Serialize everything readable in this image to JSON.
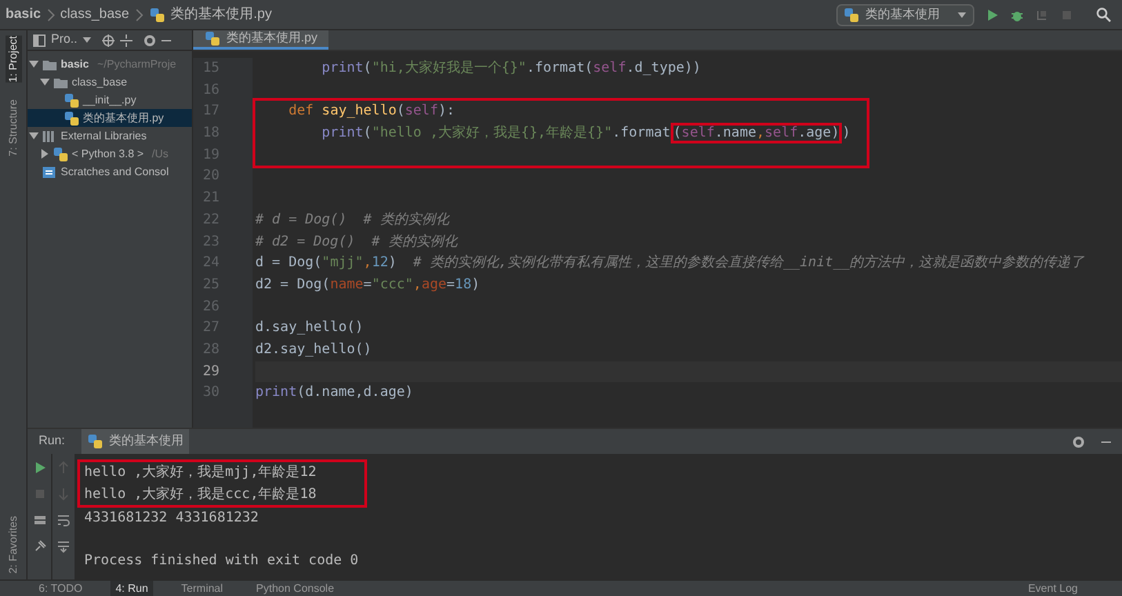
{
  "navbar": {
    "breadcrumbs": [
      "basic",
      "class_base",
      "类的基本使用.py"
    ],
    "run_config": "类的基本使用"
  },
  "tool_stripe": {
    "top": [
      {
        "label": "1: Project",
        "selected": true
      },
      {
        "label": "7: Structure",
        "selected": false
      }
    ],
    "bottom": [
      {
        "label": "2: Favorites",
        "selected": false
      }
    ]
  },
  "project": {
    "title": "Pro..",
    "tree": [
      {
        "label": "basic",
        "hint": "~/PycharmProje",
        "kind": "folder",
        "expanded": true,
        "selected": false,
        "children": [
          {
            "label": "class_base",
            "kind": "folder",
            "expanded": true,
            "selected": false,
            "children": [
              {
                "label": "__init__.py",
                "kind": "python",
                "selected": false
              },
              {
                "label": "类的基本使用.py",
                "kind": "python",
                "selected": true
              }
            ]
          }
        ]
      },
      {
        "label": "External Libraries",
        "kind": "library",
        "expanded": true,
        "selected": false,
        "children": [
          {
            "label": "< Python 3.8 >",
            "hint": "/Us",
            "kind": "sdk",
            "expanded": false,
            "selected": false
          }
        ]
      },
      {
        "label": "Scratches and Consol",
        "kind": "scratch",
        "selected": false
      }
    ]
  },
  "editor": {
    "tabs": [
      {
        "label": "类的基本使用.py",
        "selected": true
      }
    ],
    "code": [
      {
        "kind": "line",
        "number": "15",
        "current": false,
        "tokens": [
          {
            "kind": "builtin",
            "text": "        print"
          },
          {
            "kind": "plain",
            "text": "("
          },
          {
            "kind": "string",
            "text": "\"hi,大家好我是一个{}\""
          },
          {
            "kind": "plain",
            "text": ".format("
          },
          {
            "kind": "self",
            "text": "self"
          },
          {
            "kind": "plain",
            "text": ".d_type))"
          }
        ]
      },
      {
        "kind": "line",
        "number": "16",
        "current": false
      },
      {
        "kind": "box",
        "lines": [
          {
            "kind": "line",
            "number": "17",
            "current": false,
            "tokens": [
              {
                "kind": "keyword",
                "text": "    def "
              },
              {
                "kind": "function",
                "text": "say_hello"
              },
              {
                "kind": "plain",
                "text": "("
              },
              {
                "kind": "self",
                "text": "self"
              },
              {
                "kind": "plain",
                "text": "):"
              }
            ]
          },
          {
            "kind": "line",
            "number": "18",
            "current": false,
            "tokens": [
              {
                "kind": "builtin",
                "text": "        print"
              },
              {
                "kind": "plain",
                "text": "("
              },
              {
                "kind": "string",
                "text": "\"hello ,大家好，我是{},年龄是{}\""
              },
              {
                "kind": "plain",
                "text": ".format"
              },
              {
                "kind": "box",
                "tokens": [
                  {
                    "kind": "plain",
                    "text": "("
                  },
                  {
                    "kind": "self",
                    "text": "self"
                  },
                  {
                    "kind": "plain",
                    "text": ".name"
                  },
                  {
                    "kind": "keyword",
                    "text": ","
                  },
                  {
                    "kind": "self",
                    "text": "self"
                  },
                  {
                    "kind": "plain",
                    "text": ".age)"
                  }
                ]
              },
              {
                "kind": "plain",
                "text": ")"
              }
            ]
          },
          {
            "kind": "line",
            "number": "19",
            "current": false
          }
        ]
      },
      {
        "kind": "line",
        "number": "20",
        "current": false
      },
      {
        "kind": "line",
        "number": "21",
        "current": false
      },
      {
        "kind": "line",
        "number": "22",
        "current": false,
        "tokens": [
          {
            "kind": "comment",
            "text": "# d = Dog()  # 类的实例化"
          }
        ]
      },
      {
        "kind": "line",
        "number": "23",
        "current": false,
        "tokens": [
          {
            "kind": "comment",
            "text": "# d2 = Dog()  # 类的实例化"
          }
        ]
      },
      {
        "kind": "line",
        "number": "24",
        "current": false,
        "tokens": [
          {
            "kind": "plain",
            "text": "d = Dog("
          },
          {
            "kind": "string",
            "text": "\"mjj\""
          },
          {
            "kind": "keyword",
            "text": ","
          },
          {
            "kind": "number",
            "text": "12"
          },
          {
            "kind": "plain",
            "text": ")  "
          },
          {
            "kind": "comment",
            "text": "# 类的实例化,实例化带有私有属性，这里的参数会直接传给__init__的方法中，这就是函数中参数的传递了"
          }
        ]
      },
      {
        "kind": "line",
        "number": "25",
        "current": false,
        "tokens": [
          {
            "kind": "plain",
            "text": "d2 = Dog("
          },
          {
            "kind": "param",
            "text": "name"
          },
          {
            "kind": "plain",
            "text": "="
          },
          {
            "kind": "string",
            "text": "\"ccc\""
          },
          {
            "kind": "keyword",
            "text": ","
          },
          {
            "kind": "param",
            "text": "age"
          },
          {
            "kind": "plain",
            "text": "="
          },
          {
            "kind": "number",
            "text": "18"
          },
          {
            "kind": "plain",
            "text": ")"
          }
        ]
      },
      {
        "kind": "line",
        "number": "26",
        "current": false
      },
      {
        "kind": "line",
        "number": "27",
        "current": false,
        "tokens": [
          {
            "kind": "plain",
            "text": "d.say_hello()"
          }
        ]
      },
      {
        "kind": "line",
        "number": "28",
        "current": false,
        "tokens": [
          {
            "kind": "plain",
            "text": "d2.say_hello()"
          }
        ]
      },
      {
        "kind": "line",
        "number": "29",
        "current": true
      },
      {
        "kind": "line",
        "number": "30",
        "current": false,
        "tokens": [
          {
            "kind": "builtin",
            "text": "print"
          },
          {
            "kind": "plain",
            "text": "(d.name,d.age)"
          }
        ]
      }
    ]
  },
  "run": {
    "label": "Run:",
    "tab": "类的基本使用",
    "output": [
      {
        "kind": "box",
        "lines": [
          {
            "kind": "line",
            "text": "hello ,大家好，我是mjj,年龄是12"
          },
          {
            "kind": "line",
            "text": "hello ,大家好，我是ccc,年龄是18"
          }
        ]
      },
      {
        "kind": "line",
        "text": "4331681232 4331681232"
      },
      {
        "kind": "blank"
      },
      {
        "kind": "line",
        "text": "Process finished with exit code 0"
      }
    ]
  },
  "status_bar": {
    "tabs": [
      {
        "label": "6: TODO",
        "selected": false
      },
      {
        "label": "4: Run",
        "selected": true
      },
      {
        "label": "Terminal",
        "selected": false
      },
      {
        "label": "Python Console",
        "selected": false
      }
    ],
    "event_log": "Event Log"
  }
}
